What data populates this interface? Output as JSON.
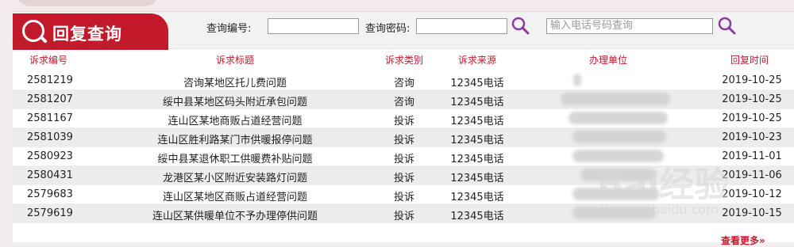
{
  "header": {
    "title": "回复查询",
    "query_id_label": "查询编号:",
    "query_pwd_label": "查询密码:",
    "phone_placeholder": "输入电话号码查询"
  },
  "table": {
    "columns": [
      "诉求编号",
      "诉求标题",
      "诉求类别",
      "诉求来源",
      "办理单位",
      "回复时间"
    ],
    "rows": [
      {
        "id": "2581219",
        "title": "咨询某地区托儿费问题",
        "category": "咨询",
        "source": "12345电话",
        "date": "2019-10-25"
      },
      {
        "id": "2581207",
        "title": "绥中县某地区码头附近承包问题",
        "category": "咨询",
        "source": "12345电话",
        "date": "2019-10-25"
      },
      {
        "id": "2581167",
        "title": "连山区某地商贩占道经营问题",
        "category": "投诉",
        "source": "12345电话",
        "date": "2019-10-25"
      },
      {
        "id": "2581039",
        "title": "连山区胜利路某门市供暖报停问题",
        "category": "投诉",
        "source": "12345电话",
        "date": "2019-10-23"
      },
      {
        "id": "2580923",
        "title": "绥中县某退休职工供暖费补贴问题",
        "category": "投诉",
        "source": "12345电话",
        "date": "2019-11-01"
      },
      {
        "id": "2580431",
        "title": "龙港区某小区附近安装路灯问题",
        "category": "投诉",
        "source": "12345电话",
        "date": "2019-11-06"
      },
      {
        "id": "2579683",
        "title": "连山区某地区商贩占道经营问题",
        "category": "投诉",
        "source": "12345电话",
        "date": "2019-10-12"
      },
      {
        "id": "2579619",
        "title": "连山区某供暖单位不予办理停供问题",
        "category": "投诉",
        "source": "12345电话",
        "date": "2019-10-15"
      }
    ]
  },
  "more_link": "查看更多»",
  "watermark": {
    "logo": "Bai经验",
    "url": "jingyan.baidu.com"
  },
  "colors": {
    "accent": "#c21a2b"
  }
}
